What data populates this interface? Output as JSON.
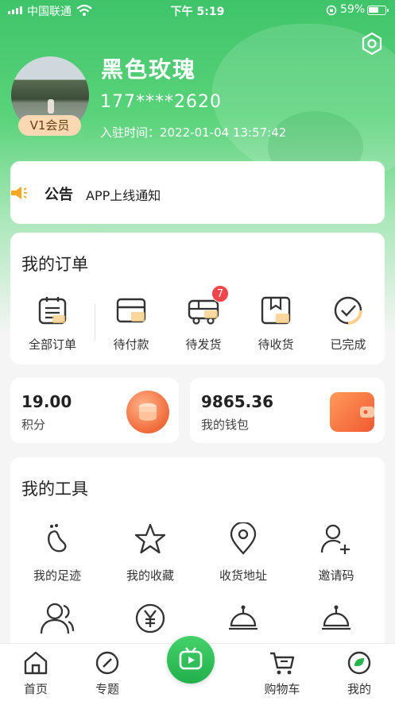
{
  "status_bar": {
    "carrier": "中国联通",
    "time": "下午 5:19",
    "battery": "59%",
    "signal_icon": "signal-bars-icon",
    "wifi_icon": "wifi-icon",
    "lock_icon": "rotation-lock-icon"
  },
  "profile": {
    "name": "黑色玫瑰",
    "phone": "177****2620",
    "joined": "入驻时间：2022-01-04 13:57:42",
    "vip_label": "V1会员"
  },
  "notice": {
    "tag": "公告",
    "message": "APP上线通知"
  },
  "orders": {
    "title": "我的订单",
    "items": [
      {
        "label": "全部订单",
        "icon": "clipboard-list-icon"
      },
      {
        "label": "待付款",
        "icon": "card-icon"
      },
      {
        "label": "待发货",
        "icon": "truck-icon",
        "badge": "7"
      },
      {
        "label": "待收货",
        "icon": "box-icon"
      },
      {
        "label": "已完成",
        "icon": "check-circle-icon"
      }
    ]
  },
  "stats": {
    "points_value": "19.00",
    "points_label": "积分",
    "wallet_value": "9865.36",
    "wallet_label": "我的钱包"
  },
  "tools": {
    "title": "我的工具",
    "items": [
      {
        "label": "我的足迹",
        "icon": "footprint-icon"
      },
      {
        "label": "我的收藏",
        "icon": "star-icon"
      },
      {
        "label": "收货地址",
        "icon": "location-pin-icon"
      },
      {
        "label": "邀请码",
        "icon": "add-user-icon"
      },
      {
        "label": "",
        "icon": "team-icon"
      },
      {
        "label": "",
        "icon": "yen-icon"
      },
      {
        "label": "",
        "icon": "cloche-icon"
      },
      {
        "label": "",
        "icon": "cloche-icon"
      }
    ]
  },
  "tabbar": {
    "items": [
      {
        "label": "首页",
        "icon": "home-icon"
      },
      {
        "label": "专题",
        "icon": "compass-icon"
      },
      {
        "label": "",
        "icon": "live-tv-icon"
      },
      {
        "label": "购物车",
        "icon": "cart-icon"
      },
      {
        "label": "我的",
        "icon": "profile-icon"
      }
    ]
  },
  "colors": {
    "brand_green": "#3fc46a",
    "badge_red": "#f0454a",
    "orange": "#f06a3a"
  }
}
